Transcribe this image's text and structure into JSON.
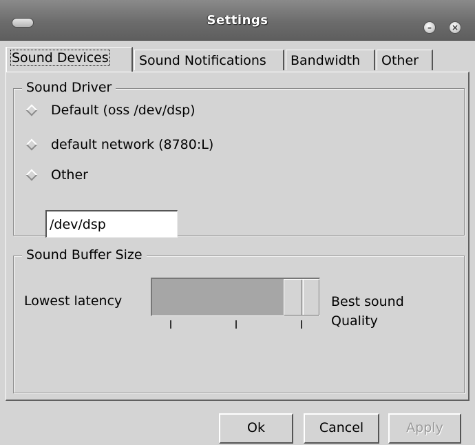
{
  "window": {
    "title": "Settings"
  },
  "tabs": [
    {
      "label": "Sound Devices",
      "active": true
    },
    {
      "label": "Sound Notifications",
      "active": false
    },
    {
      "label": "Bandwidth",
      "active": false
    },
    {
      "label": "Other",
      "active": false
    }
  ],
  "sound_driver": {
    "legend": "Sound Driver",
    "options": [
      {
        "label": "Default  (oss /dev/dsp)"
      },
      {
        "label": "default network (8780:L)"
      },
      {
        "label": "Other"
      }
    ],
    "other_value": "/dev/dsp"
  },
  "sound_buffer": {
    "legend": "Sound Buffer Size",
    "low_label": "Lowest latency",
    "high_label_line1": "Best sound",
    "high_label_line2": "Quality",
    "slider_value_fraction": 1.0,
    "tick_count": 3
  },
  "buttons": {
    "ok": "Ok",
    "cancel": "Cancel",
    "apply": "Apply"
  }
}
